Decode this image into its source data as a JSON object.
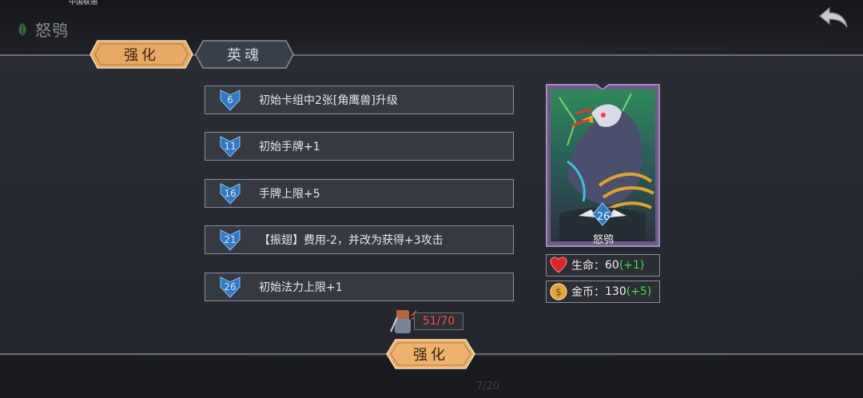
{
  "status_bar": {
    "carrier": "中国联通"
  },
  "header": {
    "title": "怒鸮",
    "back_icon": "back-arrow-icon",
    "title_icon": "leaf-icon"
  },
  "tabs": [
    {
      "label": "强化",
      "active": true
    },
    {
      "label": "英魂",
      "active": false
    }
  ],
  "upgrades": [
    {
      "level": "6",
      "text": "初始卡组中2张[角鹰兽]升级"
    },
    {
      "level": "11",
      "text": "初始手牌+1"
    },
    {
      "level": "16",
      "text": "手牌上限+5"
    },
    {
      "level": "21",
      "text": "【振翅】费用-2，并改为获得+3攻击"
    },
    {
      "level": "26",
      "text": "初始法力上限+1"
    }
  ],
  "card": {
    "name": "怒鸮",
    "level": "26"
  },
  "stats": {
    "hp": {
      "label": "生命：",
      "value": "60",
      "bonus": "(+1)",
      "icon": "heart-icon"
    },
    "gold": {
      "label": "金币：",
      "value": "130",
      "bonus": "(+5)",
      "icon": "coin-icon"
    }
  },
  "cost": {
    "text": "51/70",
    "icon": "hero-token-icon"
  },
  "action": {
    "label": "强化"
  },
  "footer": {
    "left": "",
    "middle": "7/20"
  },
  "colors": {
    "accent_gold": "#e9b36d",
    "bonus_green": "#3ee04a",
    "cost_red": "#ff4b4b",
    "badge_blue": "#3f8fd6"
  }
}
